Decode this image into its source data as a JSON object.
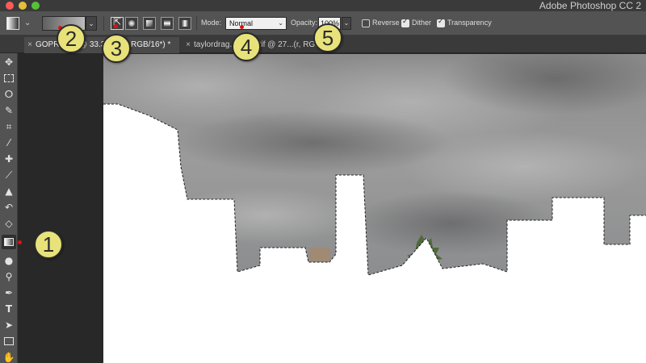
{
  "window": {
    "app_title": "Adobe Photoshop CC 2"
  },
  "options_bar": {
    "mode_label": "Mode:",
    "mode_value": "Normal",
    "opacity_label": "Opacity:",
    "opacity_value": "100%",
    "reverse_label": "Reverse",
    "reverse_checked": false,
    "dither_label": "Dither",
    "dither_checked": true,
    "transparency_label": "Transparency",
    "transparency_checked": true,
    "gradient_types": [
      "linear-gradient-icon",
      "radial-gradient-icon",
      "angle-gradient-icon",
      "reflected-gradient-icon",
      "diamond-gradient-icon"
    ],
    "active_gradient_type": "linear-gradient-icon"
  },
  "tabs": [
    {
      "label": "GOPR0...tif @ 33.3% (1d, RGB/16*) *",
      "active": true
    },
    {
      "label": "taylordrag...depth.tif @ 27...(r, RGB/8) *",
      "active": false
    }
  ],
  "toolbar": {
    "tools": [
      "move-icon",
      "marquee-icon",
      "lasso-icon",
      "quick-selection-icon",
      "crop-icon",
      "eyedropper-icon",
      "healing-brush-icon",
      "brush-icon",
      "clone-stamp-icon",
      "history-brush-icon",
      "eraser-icon",
      "gradient-icon",
      "blur-icon",
      "dodge-icon",
      "pen-icon",
      "type-icon",
      "path-selection-icon",
      "rectangle-icon",
      "hand-icon"
    ],
    "active_tool": "gradient-icon"
  },
  "callouts": [
    "1",
    "2",
    "3",
    "4",
    "5"
  ],
  "colors": {
    "callout_fill": "#e8e27a",
    "pointer": "#e01010",
    "panel": "#535353",
    "background": "#282828"
  }
}
